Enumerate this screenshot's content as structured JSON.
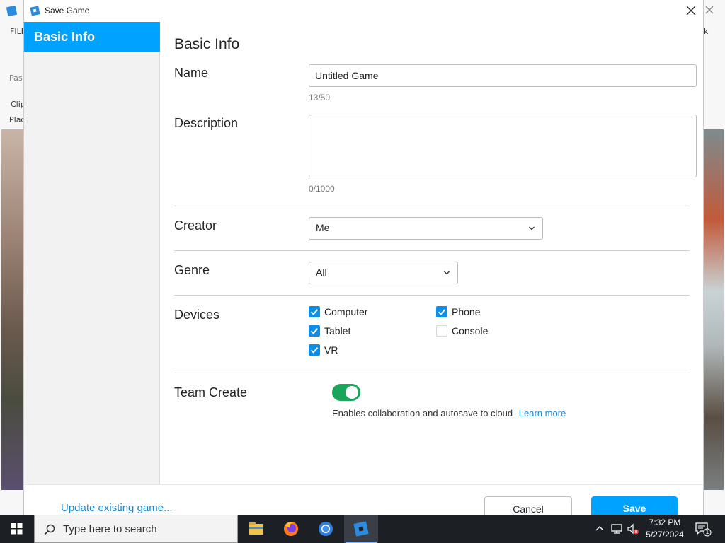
{
  "background_app": {
    "menu_partial": "FILE",
    "ribbon_partial_1": "Pas",
    "ribbon_partial_2": "Clip",
    "tab_partial": "Plac",
    "right_partial": "k"
  },
  "dialog": {
    "title": "Save Game",
    "sidebar": {
      "items": [
        {
          "label": "Basic Info",
          "selected": true
        }
      ]
    },
    "content": {
      "section_title": "Basic Info",
      "name": {
        "label": "Name",
        "value": "Untitled Game",
        "counter": "13/50"
      },
      "description": {
        "label": "Description",
        "value": "",
        "counter": "0/1000"
      },
      "creator": {
        "label": "Creator",
        "selected": "Me"
      },
      "genre": {
        "label": "Genre",
        "selected": "All"
      },
      "devices": {
        "label": "Devices",
        "options": [
          {
            "label": "Computer",
            "checked": true
          },
          {
            "label": "Phone",
            "checked": true
          },
          {
            "label": "Tablet",
            "checked": true
          },
          {
            "label": "Console",
            "checked": false
          },
          {
            "label": "VR",
            "checked": true
          }
        ]
      },
      "team_create": {
        "label": "Team Create",
        "enabled": true,
        "helper": "Enables collaboration and autosave to cloud",
        "learn_more": "Learn more"
      }
    },
    "footer": {
      "update_link": "Update existing game...",
      "cancel": "Cancel",
      "save": "Save"
    }
  },
  "taskbar": {
    "search_placeholder": "Type here to search",
    "time": "7:32 PM",
    "date": "5/27/2024",
    "notification_count": "1"
  },
  "colors": {
    "accent": "#00a2ff",
    "toggle_on": "#1aa55a",
    "checkbox_on": "#0d8ee8",
    "link": "#1c8ad6"
  },
  "icons": [
    "roblox-studio-icon",
    "close-icon",
    "chevron-down-icon",
    "checkmark-icon",
    "windows-start-icon",
    "search-icon",
    "file-explorer-icon",
    "firefox-icon",
    "chrome-icon",
    "roblox-studio-icon",
    "chevron-up-icon",
    "network-icon",
    "speaker-muted-icon",
    "notification-icon"
  ]
}
